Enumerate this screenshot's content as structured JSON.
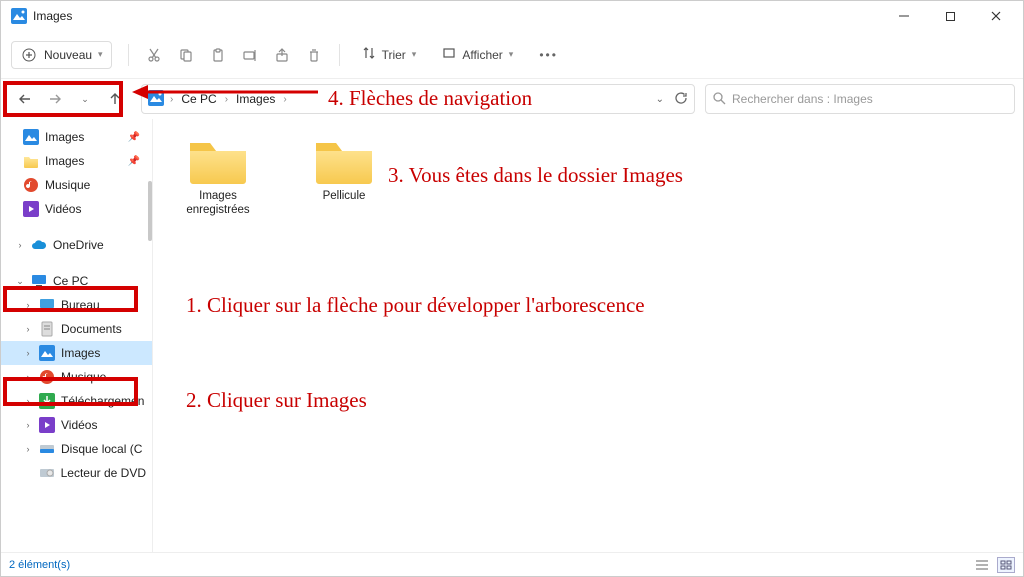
{
  "window": {
    "title": "Images"
  },
  "cmdbar": {
    "new_label": "Nouveau",
    "sort_label": "Trier",
    "view_label": "Afficher"
  },
  "breadcrumb": {
    "items": [
      "Ce PC",
      "Images"
    ],
    "search_placeholder": "Rechercher dans : Images"
  },
  "sidebar": {
    "quick": [
      {
        "label": "Images",
        "icon": "pictures-blue",
        "pinned": true
      },
      {
        "label": "Images",
        "icon": "folder-yellow",
        "pinned": true
      },
      {
        "label": "Musique",
        "icon": "music",
        "pinned": false
      },
      {
        "label": "Vidéos",
        "icon": "videos",
        "pinned": false
      }
    ],
    "onedrive": {
      "label": "OneDrive"
    },
    "thispc": {
      "label": "Ce PC"
    },
    "thispc_children": [
      {
        "label": "Bureau",
        "icon": "desktop"
      },
      {
        "label": "Documents",
        "icon": "documents"
      },
      {
        "label": "Images",
        "icon": "pictures-blue",
        "selected": true
      },
      {
        "label": "Musique",
        "icon": "music"
      },
      {
        "label": "Téléchargemen",
        "icon": "downloads"
      },
      {
        "label": "Vidéos",
        "icon": "videos"
      },
      {
        "label": "Disque local (C",
        "icon": "disk"
      },
      {
        "label": "Lecteur de DVD",
        "icon": "dvd"
      }
    ]
  },
  "content": {
    "folders": [
      {
        "label": "Images enregistrées"
      },
      {
        "label": "Pellicule"
      }
    ]
  },
  "status": {
    "text": "2 élément(s)"
  },
  "annotations": {
    "a1": "1. Cliquer sur la flèche pour développer l'arborescence",
    "a2": "2. Cliquer sur Images",
    "a3": "3. Vous êtes dans le dossier Images",
    "a4": "4. Flèches de navigation"
  }
}
